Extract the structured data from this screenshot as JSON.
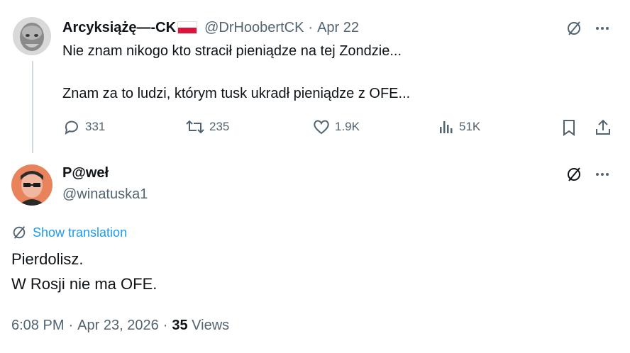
{
  "reply_to_tweet": {
    "display_name": "Arcyksiążę—-CK",
    "handle": "@DrHoobertCK",
    "separator": "·",
    "date": "Apr 22",
    "text_line1": "Nie znam nikogo kto stracił pieniądze na tej Zondzie...",
    "text_line2": "Znam za to ludzi, którym tusk ukradł pieniądze z OFE...",
    "replies": "331",
    "reposts": "235",
    "likes": "1.9K",
    "views": "51K",
    "flag_colors": [
      "#ffffff",
      "#dc143c"
    ]
  },
  "main_tweet": {
    "display_name": "P@weł",
    "handle": "@winatuska1",
    "show_translation": "Show translation",
    "text_line1": "Pierdolisz.",
    "text_line2": "W Rosji nie ma OFE.",
    "time": "6:08 PM",
    "sep1": "·",
    "date": "Apr 23, 2026",
    "sep2": "·",
    "views_count": "35",
    "views_label": "Views"
  },
  "icons": {
    "grok": "grok-icon",
    "more": "more-icon",
    "reply": "reply-icon",
    "repost": "repost-icon",
    "like": "like-icon",
    "views": "views-icon",
    "bookmark": "bookmark-icon",
    "share": "share-icon",
    "translate": "translate-icon"
  },
  "colors": {
    "text": "#0f1419",
    "muted": "#536471",
    "link": "#1d9bf0",
    "thread_line": "#cfd9de"
  }
}
